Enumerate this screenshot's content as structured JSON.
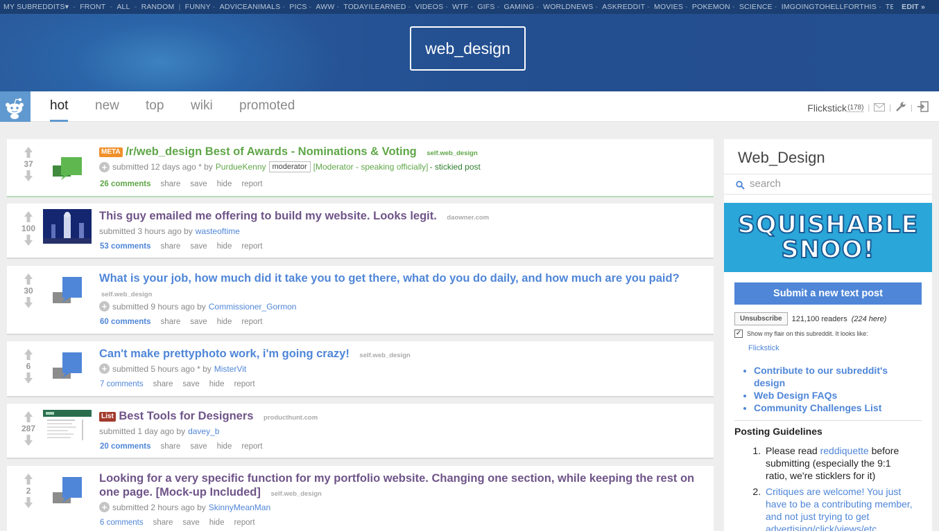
{
  "topbar": {
    "my_subreddits": "MY SUBREDDITS▾",
    "front": "FRONT",
    "all": "ALL",
    "random": "RANDOM",
    "subs": [
      "FUNNY",
      "ADVICEANIMALS",
      "PICS",
      "AWW",
      "TODAYILEARNED",
      "VIDEOS",
      "WTF",
      "GIFS",
      "GAMING",
      "WORLDNEWS",
      "ASKREDDIT",
      "MOVIES",
      "POKEMON",
      "SCIENCE",
      "IMGOINGTOHELLFORTHIS",
      "TECHNO"
    ],
    "edit": "EDIT »"
  },
  "header": {
    "subreddit_logo": "web_design"
  },
  "nav": {
    "tabs": [
      "hot",
      "new",
      "top",
      "wiki",
      "promoted"
    ],
    "active_tab": "hot",
    "username": "Flickstick",
    "karma": "(178)"
  },
  "posts": [
    {
      "score": "37",
      "tag": "META",
      "title": "/r/web_design Best of Awards - Nominations & Voting",
      "domain": "self.web_design",
      "submitted": "submitted 12 days ago * by",
      "author": "PurdueKenny",
      "mod_label": "moderator",
      "mod_note": "[Moderator - speaking officially]",
      "sticky": "- stickied post",
      "comments": "26 comments",
      "actions": [
        "share",
        "save",
        "hide",
        "report"
      ]
    },
    {
      "score": "100",
      "title": "This guy emailed me offering to build my website. Looks legit.",
      "domain": "daowner.com",
      "submitted": "submitted 3 hours ago by",
      "author": "wasteoftime",
      "comments": "53 comments",
      "actions": [
        "share",
        "save",
        "hide",
        "report"
      ]
    },
    {
      "score": "30",
      "title": "What is your job, how much did it take you to get there, what do you do daily, and how much are you paid?",
      "domain": "self.web_design",
      "submitted": "submitted 9 hours ago by",
      "author": "Commissioner_Gormon",
      "comments": "60 comments",
      "actions": [
        "share",
        "save",
        "hide",
        "report"
      ]
    },
    {
      "score": "6",
      "title": "Can't make prettyphoto work, i'm going crazy!",
      "domain": "self.web_design",
      "submitted": "submitted 5 hours ago * by",
      "author": "MisterVit",
      "comments": "7 comments",
      "actions": [
        "share",
        "save",
        "hide",
        "report"
      ]
    },
    {
      "score": "287",
      "tag": "List",
      "title": "Best Tools for Designers",
      "domain": "producthunt.com",
      "submitted": "submitted 1 day ago by",
      "author": "davey_b",
      "comments": "20 comments",
      "actions": [
        "share",
        "save",
        "hide",
        "report"
      ]
    },
    {
      "score": "2",
      "title": "Looking for a very specific function for my portfolio website. Changing one section, while keeping the rest on one page. [Mock-up Included]",
      "domain": "self.web_design",
      "submitted": "submitted 2 hours ago by",
      "author": "SkinnyMeanMan",
      "comments": "6 comments",
      "actions": [
        "share",
        "save",
        "hide",
        "report"
      ]
    }
  ],
  "sidebar": {
    "title": "Web_Design",
    "search_placeholder": "search",
    "ad_line1": "SQUISHABLE",
    "ad_line2": "SNOO!",
    "submit_button": "Submit a new text post",
    "unsubscribe": "Unsubscribe",
    "readers": "121,100 readers",
    "here": "(224 here)",
    "flair_text": "Show my flair on this subreddit. It looks like:",
    "flair_name": "Flickstick",
    "links": [
      "Contribute to our subreddit's design",
      "Web Design FAQs",
      "Community Challenges List"
    ],
    "guidelines_title": "Posting Guidelines",
    "guideline1_pre": "Please read",
    "guideline1_link": "reddiquette",
    "guideline1_post": "before submitting (especially the 9:1 ratio, we're sticklers for it)",
    "guideline2": "Critiques are welcome! You just have to be a contributing member, and not just trying to get advertising/click/views/etc."
  },
  "colors": {
    "accent": "#4f86d8",
    "header_bg": "#234e8f",
    "sticky_green": "#5fa648",
    "visited": "#6f5488"
  }
}
